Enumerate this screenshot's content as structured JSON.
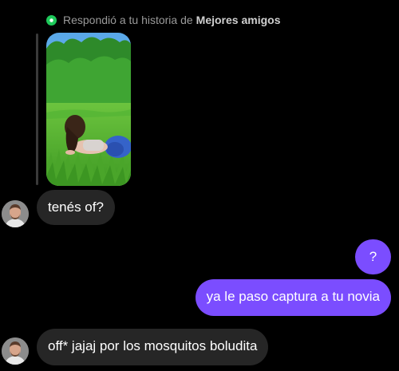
{
  "reply_header": {
    "prefix": "Respondió a tu historia de",
    "audience": "Mejores amigos",
    "indicator_color": "#1ec95a"
  },
  "messages": [
    {
      "side": "incoming",
      "text": "tenés of?"
    },
    {
      "side": "outgoing",
      "text": "?"
    },
    {
      "side": "outgoing",
      "text": "ya le paso captura a tu novia"
    },
    {
      "side": "incoming",
      "text": "off* jajaj por los mosquitos boludita"
    }
  ],
  "colors": {
    "background": "#000000",
    "incoming_bubble": "#262626",
    "outgoing_bubble": "#7b4dff"
  }
}
